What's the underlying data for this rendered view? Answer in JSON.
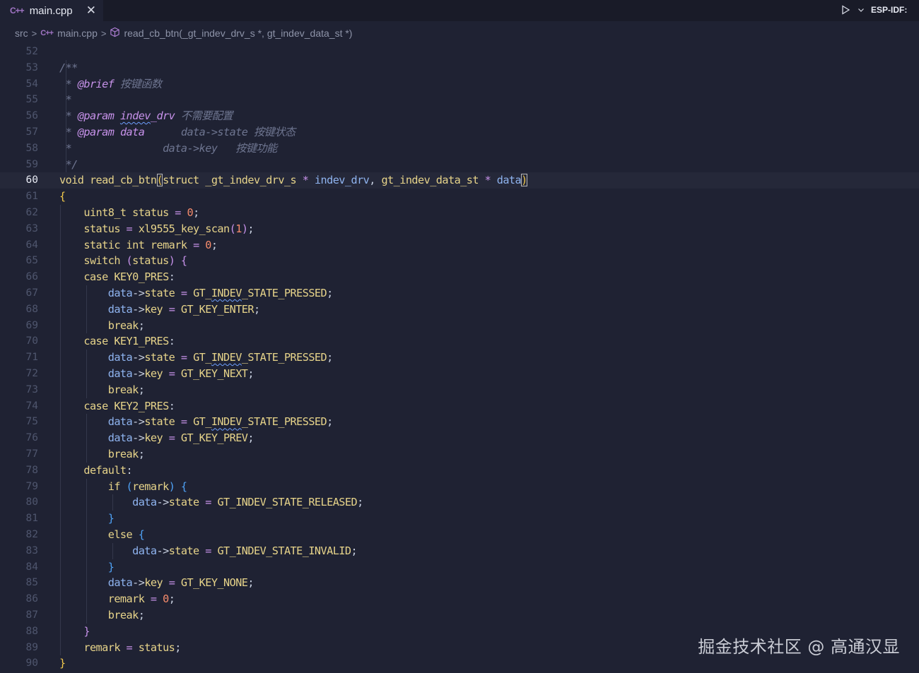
{
  "tab": {
    "icon": "cpp-file-icon",
    "label": "main.cpp",
    "close": "✕"
  },
  "toolbar": {
    "run_icon": "play-icon",
    "dropdown_icon": "chevron-down-icon",
    "label": "ESP-IDF: "
  },
  "breadcrumb": {
    "folder": "src",
    "file": "main.cpp",
    "symbol": "read_cb_btn(_gt_indev_drv_s *, gt_indev_data_st *)"
  },
  "colors": {
    "background": "#1f2233",
    "keyword": "#e7d48a",
    "variable": "#8fb4f0",
    "comment": "#6e7590",
    "doc_tag": "#c792ea"
  },
  "current_line": "60",
  "lines": [
    {
      "n": "52",
      "tokens": []
    },
    {
      "n": "53",
      "tokens": [
        [
          "cmt",
          "/**"
        ]
      ]
    },
    {
      "n": "54",
      "tokens": [
        [
          "cmt",
          " * "
        ],
        [
          "doc",
          "@brief"
        ],
        [
          "cmt",
          " 按键函数"
        ]
      ]
    },
    {
      "n": "55",
      "tokens": [
        [
          "cmt",
          " *"
        ]
      ]
    },
    {
      "n": "56",
      "tokens": [
        [
          "cmt",
          " * "
        ],
        [
          "doc",
          "@param"
        ],
        [
          "cmt",
          " "
        ],
        [
          "docsq",
          "indev"
        ],
        [
          "doc",
          "_drv"
        ],
        [
          "cmt",
          " 不需要配置"
        ]
      ]
    },
    {
      "n": "57",
      "tokens": [
        [
          "cmt",
          " * "
        ],
        [
          "doc",
          "@param"
        ],
        [
          "cmt",
          " "
        ],
        [
          "doc",
          "data"
        ],
        [
          "cmt",
          "      data->state 按键状态"
        ]
      ]
    },
    {
      "n": "58",
      "tokens": [
        [
          "cmt",
          " *               data->key   按键功能"
        ]
      ]
    },
    {
      "n": "59",
      "tokens": [
        [
          "cmt",
          " */"
        ]
      ]
    },
    {
      "n": "60",
      "tokens": [
        [
          "kw",
          "void"
        ],
        [
          "pun",
          " "
        ],
        [
          "fn",
          "read_cb_btn"
        ],
        [
          "br1box",
          "("
        ],
        [
          "kw",
          "struct"
        ],
        [
          "pun",
          " "
        ],
        [
          "typ",
          "_gt_indev_drv_s"
        ],
        [
          "pun",
          " "
        ],
        [
          "op",
          "*"
        ],
        [
          "pun",
          " "
        ],
        [
          "var",
          "indev_drv"
        ],
        [
          "pun",
          ", "
        ],
        [
          "typ",
          "gt_indev_data_st"
        ],
        [
          "pun",
          " "
        ],
        [
          "op",
          "*"
        ],
        [
          "pun",
          " "
        ],
        [
          "var",
          "data"
        ],
        [
          "br1box",
          ")"
        ]
      ]
    },
    {
      "n": "61",
      "tokens": [
        [
          "br1",
          "{"
        ]
      ]
    },
    {
      "n": "62",
      "tokens": [
        [
          "pun",
          "    "
        ],
        [
          "typ",
          "uint8_t"
        ],
        [
          "pun",
          " "
        ],
        [
          "prop",
          "status"
        ],
        [
          "pun",
          " "
        ],
        [
          "op",
          "="
        ],
        [
          "pun",
          " "
        ],
        [
          "num",
          "0"
        ],
        [
          "pun",
          ";"
        ]
      ]
    },
    {
      "n": "63",
      "tokens": [
        [
          "pun",
          "    "
        ],
        [
          "prop",
          "status"
        ],
        [
          "pun",
          " "
        ],
        [
          "op",
          "="
        ],
        [
          "pun",
          " "
        ],
        [
          "fn",
          "xl9555_key_scan"
        ],
        [
          "br2",
          "("
        ],
        [
          "num",
          "1"
        ],
        [
          "br2",
          ")"
        ],
        [
          "pun",
          ";"
        ]
      ]
    },
    {
      "n": "64",
      "tokens": [
        [
          "pun",
          "    "
        ],
        [
          "kw",
          "static"
        ],
        [
          "pun",
          " "
        ],
        [
          "kw",
          "int"
        ],
        [
          "pun",
          " "
        ],
        [
          "prop",
          "remark"
        ],
        [
          "pun",
          " "
        ],
        [
          "op",
          "="
        ],
        [
          "pun",
          " "
        ],
        [
          "num",
          "0"
        ],
        [
          "pun",
          ";"
        ]
      ]
    },
    {
      "n": "65",
      "tokens": [
        [
          "pun",
          "    "
        ],
        [
          "kw",
          "switch"
        ],
        [
          "pun",
          " "
        ],
        [
          "br2",
          "("
        ],
        [
          "prop",
          "status"
        ],
        [
          "br2",
          ")"
        ],
        [
          "pun",
          " "
        ],
        [
          "br2",
          "{"
        ]
      ]
    },
    {
      "n": "66",
      "tokens": [
        [
          "pun",
          "    "
        ],
        [
          "kw",
          "case"
        ],
        [
          "pun",
          " "
        ],
        [
          "mac",
          "KEY0_PRES"
        ],
        [
          "pun",
          ":"
        ]
      ]
    },
    {
      "n": "67",
      "tokens": [
        [
          "pun",
          "        "
        ],
        [
          "var",
          "data"
        ],
        [
          "pun",
          "->"
        ],
        [
          "prop",
          "state"
        ],
        [
          "pun",
          " "
        ],
        [
          "op",
          "="
        ],
        [
          "pun",
          " "
        ],
        [
          "mac",
          "GT_"
        ],
        [
          "macsq",
          "INDEV"
        ],
        [
          "mac",
          "_STATE_PRESSED"
        ],
        [
          "pun",
          ";"
        ]
      ]
    },
    {
      "n": "68",
      "tokens": [
        [
          "pun",
          "        "
        ],
        [
          "var",
          "data"
        ],
        [
          "pun",
          "->"
        ],
        [
          "prop",
          "key"
        ],
        [
          "pun",
          " "
        ],
        [
          "op",
          "="
        ],
        [
          "pun",
          " "
        ],
        [
          "mac",
          "GT_KEY_ENTER"
        ],
        [
          "pun",
          ";"
        ]
      ]
    },
    {
      "n": "69",
      "tokens": [
        [
          "pun",
          "        "
        ],
        [
          "kw",
          "break"
        ],
        [
          "pun",
          ";"
        ]
      ]
    },
    {
      "n": "70",
      "tokens": [
        [
          "pun",
          "    "
        ],
        [
          "kw",
          "case"
        ],
        [
          "pun",
          " "
        ],
        [
          "mac",
          "KEY1_PRES"
        ],
        [
          "pun",
          ":"
        ]
      ]
    },
    {
      "n": "71",
      "tokens": [
        [
          "pun",
          "        "
        ],
        [
          "var",
          "data"
        ],
        [
          "pun",
          "->"
        ],
        [
          "prop",
          "state"
        ],
        [
          "pun",
          " "
        ],
        [
          "op",
          "="
        ],
        [
          "pun",
          " "
        ],
        [
          "mac",
          "GT_"
        ],
        [
          "macsq",
          "INDEV"
        ],
        [
          "mac",
          "_STATE_PRESSED"
        ],
        [
          "pun",
          ";"
        ]
      ]
    },
    {
      "n": "72",
      "tokens": [
        [
          "pun",
          "        "
        ],
        [
          "var",
          "data"
        ],
        [
          "pun",
          "->"
        ],
        [
          "prop",
          "key"
        ],
        [
          "pun",
          " "
        ],
        [
          "op",
          "="
        ],
        [
          "pun",
          " "
        ],
        [
          "mac",
          "GT_KEY_NEXT"
        ],
        [
          "pun",
          ";"
        ]
      ]
    },
    {
      "n": "73",
      "tokens": [
        [
          "pun",
          "        "
        ],
        [
          "kw",
          "break"
        ],
        [
          "pun",
          ";"
        ]
      ]
    },
    {
      "n": "74",
      "tokens": [
        [
          "pun",
          "    "
        ],
        [
          "kw",
          "case"
        ],
        [
          "pun",
          " "
        ],
        [
          "mac",
          "KEY2_PRES"
        ],
        [
          "pun",
          ":"
        ]
      ]
    },
    {
      "n": "75",
      "tokens": [
        [
          "pun",
          "        "
        ],
        [
          "var",
          "data"
        ],
        [
          "pun",
          "->"
        ],
        [
          "prop",
          "state"
        ],
        [
          "pun",
          " "
        ],
        [
          "op",
          "="
        ],
        [
          "pun",
          " "
        ],
        [
          "mac",
          "GT_"
        ],
        [
          "macsq",
          "INDEV"
        ],
        [
          "mac",
          "_STATE_PRESSED"
        ],
        [
          "pun",
          ";"
        ]
      ]
    },
    {
      "n": "76",
      "tokens": [
        [
          "pun",
          "        "
        ],
        [
          "var",
          "data"
        ],
        [
          "pun",
          "->"
        ],
        [
          "prop",
          "key"
        ],
        [
          "pun",
          " "
        ],
        [
          "op",
          "="
        ],
        [
          "pun",
          " "
        ],
        [
          "mac",
          "GT_KEY_PREV"
        ],
        [
          "pun",
          ";"
        ]
      ]
    },
    {
      "n": "77",
      "tokens": [
        [
          "pun",
          "        "
        ],
        [
          "kw",
          "break"
        ],
        [
          "pun",
          ";"
        ]
      ]
    },
    {
      "n": "78",
      "tokens": [
        [
          "pun",
          "    "
        ],
        [
          "kw",
          "default"
        ],
        [
          "pun",
          ":"
        ]
      ]
    },
    {
      "n": "79",
      "tokens": [
        [
          "pun",
          "        "
        ],
        [
          "kw",
          "if"
        ],
        [
          "pun",
          " "
        ],
        [
          "br3",
          "("
        ],
        [
          "prop",
          "remark"
        ],
        [
          "br3",
          ")"
        ],
        [
          "pun",
          " "
        ],
        [
          "br3",
          "{"
        ]
      ]
    },
    {
      "n": "80",
      "tokens": [
        [
          "pun",
          "            "
        ],
        [
          "var",
          "data"
        ],
        [
          "pun",
          "->"
        ],
        [
          "prop",
          "state"
        ],
        [
          "pun",
          " "
        ],
        [
          "op",
          "="
        ],
        [
          "pun",
          " "
        ],
        [
          "mac",
          "GT_INDEV_STATE_RELEASED"
        ],
        [
          "pun",
          ";"
        ]
      ]
    },
    {
      "n": "81",
      "tokens": [
        [
          "pun",
          "        "
        ],
        [
          "br3",
          "}"
        ]
      ]
    },
    {
      "n": "82",
      "tokens": [
        [
          "pun",
          "        "
        ],
        [
          "kw",
          "else"
        ],
        [
          "pun",
          " "
        ],
        [
          "br3",
          "{"
        ]
      ]
    },
    {
      "n": "83",
      "tokens": [
        [
          "pun",
          "            "
        ],
        [
          "var",
          "data"
        ],
        [
          "pun",
          "->"
        ],
        [
          "prop",
          "state"
        ],
        [
          "pun",
          " "
        ],
        [
          "op",
          "="
        ],
        [
          "pun",
          " "
        ],
        [
          "mac",
          "GT_INDEV_STATE_INVALID"
        ],
        [
          "pun",
          ";"
        ]
      ]
    },
    {
      "n": "84",
      "tokens": [
        [
          "pun",
          "        "
        ],
        [
          "br3",
          "}"
        ]
      ]
    },
    {
      "n": "85",
      "tokens": [
        [
          "pun",
          "        "
        ],
        [
          "var",
          "data"
        ],
        [
          "pun",
          "->"
        ],
        [
          "prop",
          "key"
        ],
        [
          "pun",
          " "
        ],
        [
          "op",
          "="
        ],
        [
          "pun",
          " "
        ],
        [
          "mac",
          "GT_KEY_NONE"
        ],
        [
          "pun",
          ";"
        ]
      ]
    },
    {
      "n": "86",
      "tokens": [
        [
          "pun",
          "        "
        ],
        [
          "prop",
          "remark"
        ],
        [
          "pun",
          " "
        ],
        [
          "op",
          "="
        ],
        [
          "pun",
          " "
        ],
        [
          "num",
          "0"
        ],
        [
          "pun",
          ";"
        ]
      ]
    },
    {
      "n": "87",
      "tokens": [
        [
          "pun",
          "        "
        ],
        [
          "kw",
          "break"
        ],
        [
          "pun",
          ";"
        ]
      ]
    },
    {
      "n": "88",
      "tokens": [
        [
          "pun",
          "    "
        ],
        [
          "br2",
          "}"
        ]
      ]
    },
    {
      "n": "89",
      "tokens": [
        [
          "pun",
          "    "
        ],
        [
          "prop",
          "remark"
        ],
        [
          "pun",
          " "
        ],
        [
          "op",
          "="
        ],
        [
          "pun",
          " "
        ],
        [
          "prop",
          "status"
        ],
        [
          "pun",
          ";"
        ]
      ]
    },
    {
      "n": "90",
      "tokens": [
        [
          "br1",
          "}"
        ]
      ]
    }
  ],
  "watermark": "掘金技术社区 @ 高通汉显"
}
